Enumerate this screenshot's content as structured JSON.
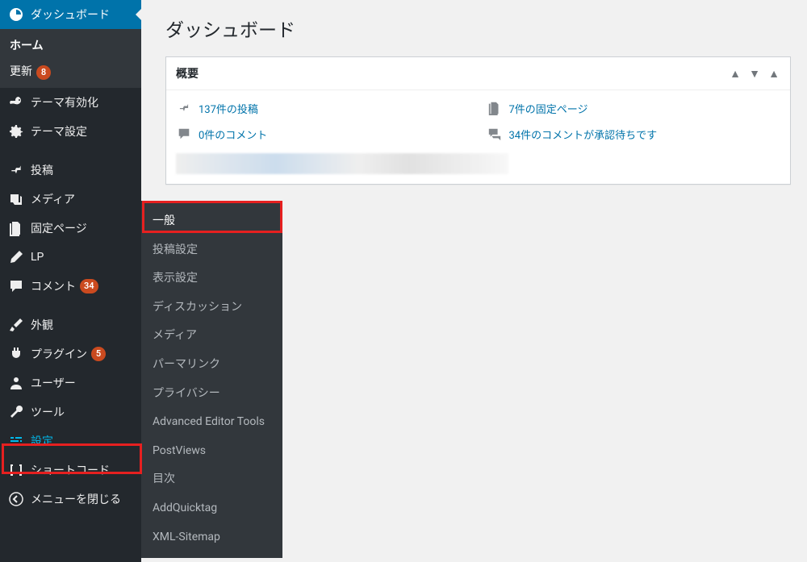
{
  "sidebar": {
    "dashboard": "ダッシュボード",
    "home": "ホーム",
    "updates": "更新",
    "updates_count": "8",
    "theme_activate": "テーマ有効化",
    "theme_settings": "テーマ設定",
    "posts": "投稿",
    "media": "メディア",
    "pages": "固定ページ",
    "lp": "LP",
    "comments": "コメント",
    "comments_count": "34",
    "appearance": "外観",
    "plugins": "プラグイン",
    "plugins_count": "5",
    "users": "ユーザー",
    "tools": "ツール",
    "settings": "設定",
    "shortcode": "ショートコード",
    "collapse": "メニューを閉じる"
  },
  "flyout": {
    "general": "一般",
    "writing": "投稿設定",
    "reading": "表示設定",
    "discussion": "ディスカッション",
    "media": "メディア",
    "permalinks": "パーマリンク",
    "privacy": "プライバシー",
    "aet": "Advanced Editor Tools",
    "postviews": "PostViews",
    "toc": "目次",
    "addquicktag": "AddQuicktag",
    "xmlsitemap": "XML-Sitemap"
  },
  "main": {
    "title": "ダッシュボード",
    "overview": {
      "heading": "概要",
      "posts": "137件の投稿",
      "pages": "7件の固定ページ",
      "comments": "0件のコメント",
      "pending": "34件のコメントが承認待ちです"
    }
  }
}
